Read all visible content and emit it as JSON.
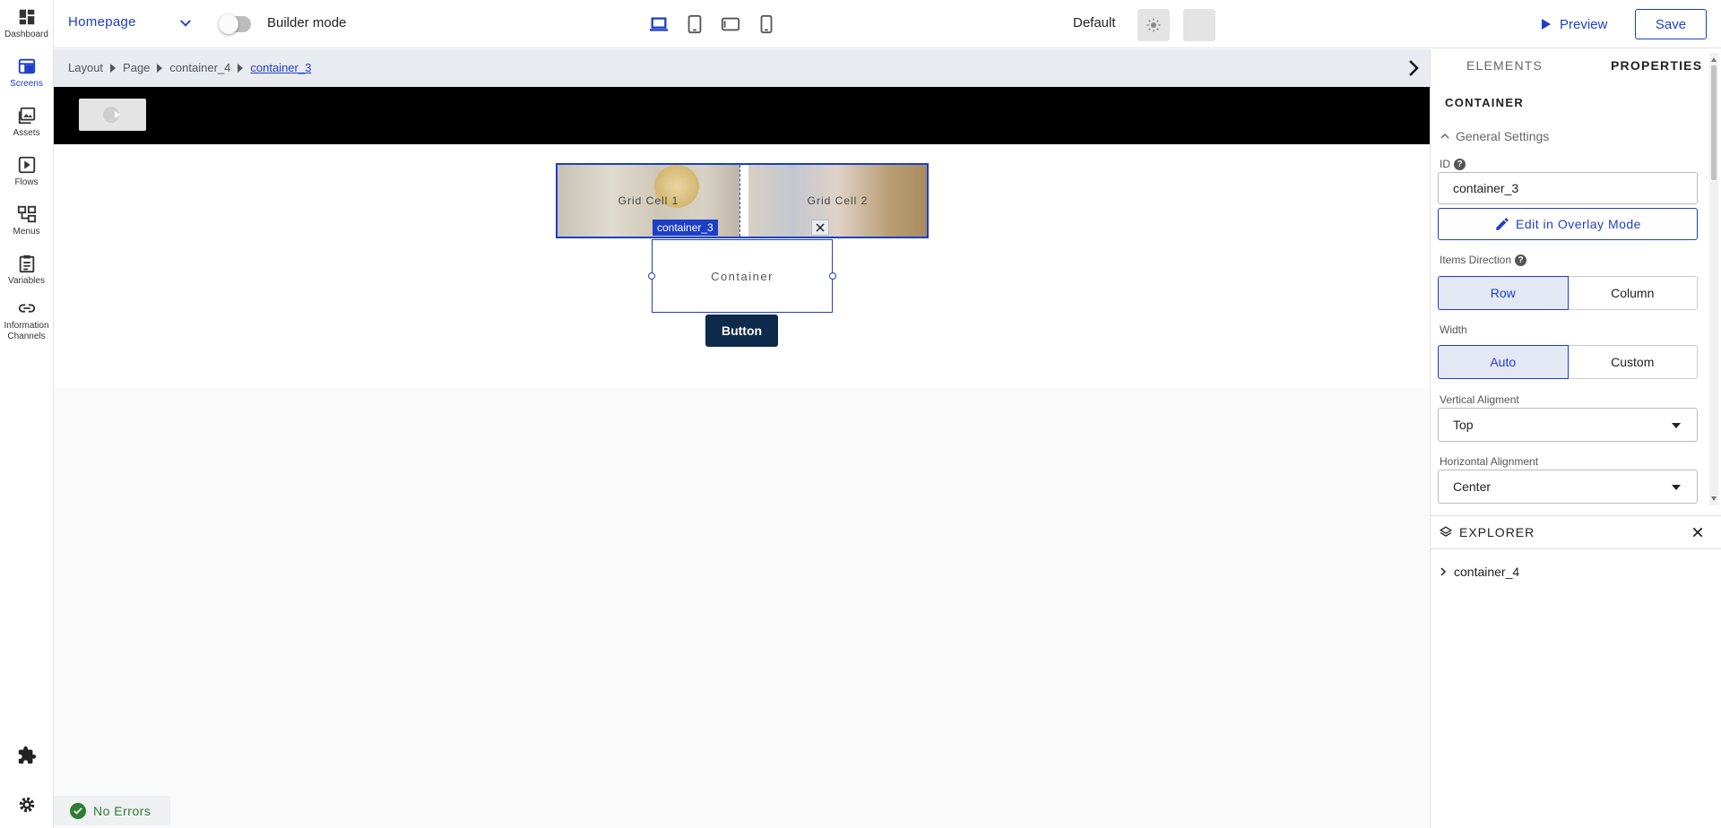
{
  "nav": {
    "items": [
      {
        "label": "Dashboard",
        "icon": "dashboard-icon"
      },
      {
        "label": "Screens",
        "icon": "screens-icon"
      },
      {
        "label": "Assets",
        "icon": "assets-icon"
      },
      {
        "label": "Flows",
        "icon": "flows-icon"
      },
      {
        "label": "Menus",
        "icon": "menus-icon"
      },
      {
        "label": "Variables",
        "icon": "variables-icon"
      },
      {
        "label": "Information Channels",
        "icon": "link-icon"
      }
    ],
    "active": "Screens",
    "bottom_icons": [
      "puzzle-icon",
      "gear-icon"
    ]
  },
  "topbar": {
    "page_select": "Homepage",
    "builder_mode_label": "Builder mode",
    "builder_mode_on": false,
    "devices": [
      "laptop-icon",
      "tablet-icon",
      "tablet-landscape-icon",
      "phone-icon"
    ],
    "active_device": "laptop-icon",
    "theme_label": "Default",
    "preview_label": "Preview",
    "save_label": "Save"
  },
  "breadcrumb": [
    "Layout",
    "Page",
    "container_4",
    "container_3"
  ],
  "canvas": {
    "grid_cells": [
      "Grid Cell 1",
      "Grid Cell 2"
    ],
    "selected_tag": "container_3",
    "container_label": "Container",
    "button_label": "Button",
    "status": "No Errors"
  },
  "panel": {
    "tabs": [
      "ELEMENTS",
      "PROPERTIES"
    ],
    "active_tab": "PROPERTIES",
    "section_title": "CONTAINER",
    "group_title": "General Settings",
    "id_label": "ID",
    "id_value": "container_3",
    "overlay_button": "Edit in Overlay Mode",
    "items_direction_label": "Items Direction",
    "items_direction_options": [
      "Row",
      "Column"
    ],
    "items_direction_selected": "Row",
    "width_label": "Width",
    "width_options": [
      "Auto",
      "Custom"
    ],
    "width_selected": "Auto",
    "vertical_alignment_label": "Vertical Aligment",
    "vertical_alignment_value": "Top",
    "horizontal_alignment_label": "Horizontal Alignment",
    "horizontal_alignment_value": "Center",
    "explorer_title": "EXPLORER",
    "tree_root": "container_4"
  },
  "colors": {
    "accent": "#1d3fc7",
    "button_bg": "#0e2a4a",
    "success": "#2e7d32"
  }
}
